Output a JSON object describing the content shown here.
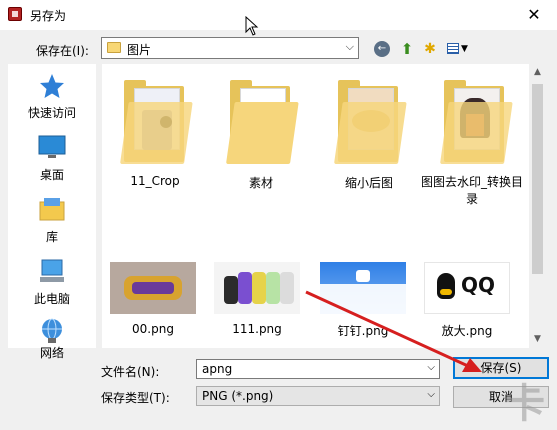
{
  "window": {
    "title": "另存为",
    "close_glyph": "✕"
  },
  "location": {
    "label": "保存在(I):",
    "value": "图片"
  },
  "toolbar": {
    "back_icon": "back-arrow-icon",
    "up_icon": "up-folder-icon",
    "new_folder_icon": "new-folder-icon",
    "view_icon": "view-menu-icon"
  },
  "nav": {
    "items": [
      {
        "label": "快速访问",
        "icon": "star-icon"
      },
      {
        "label": "桌面",
        "icon": "desktop-icon"
      },
      {
        "label": "库",
        "icon": "library-icon"
      },
      {
        "label": "此电脑",
        "icon": "computer-icon"
      },
      {
        "label": "网络",
        "icon": "network-icon"
      }
    ]
  },
  "files": {
    "folders": [
      {
        "name": "11_Crop"
      },
      {
        "name": "素材"
      },
      {
        "name": "缩小后图"
      },
      {
        "name": "图图去水印_转换目录",
        "name_line1": "图图去水印_转换目",
        "name_line2": "录"
      }
    ],
    "images": [
      {
        "name": "00.png"
      },
      {
        "name": "111.png"
      },
      {
        "name": "钉钉.png"
      },
      {
        "name": "放大.png",
        "thumb_text": "QQ"
      }
    ]
  },
  "filename": {
    "label": "文件名(N):",
    "value": "apng"
  },
  "filetype": {
    "label": "保存类型(T):",
    "value": "PNG (*.png)"
  },
  "buttons": {
    "save": "保存(S)",
    "cancel": "取消"
  },
  "colors": {
    "accent": "#0078d7",
    "annotation_arrow": "#d61f1f",
    "folder": "#f6d67c"
  }
}
